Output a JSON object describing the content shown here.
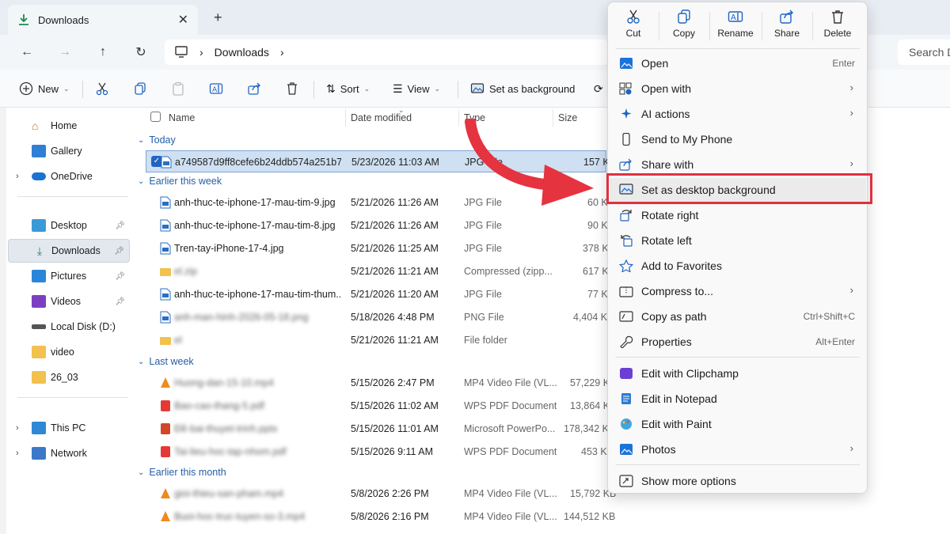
{
  "tab": {
    "title": "Downloads",
    "close": "✕",
    "new": "+"
  },
  "address": {
    "path_label": "Downloads",
    "search_placeholder": "Search D"
  },
  "toolbar": {
    "new_label": "New",
    "sort_label": "Sort",
    "view_label": "View",
    "set_bg_label": "Set as background"
  },
  "sidebar": {
    "home": "Home",
    "gallery": "Gallery",
    "onedrive": "OneDrive",
    "desktop": "Desktop",
    "downloads": "Downloads",
    "pictures": "Pictures",
    "videos": "Videos",
    "localdisk": "Local Disk (D:)",
    "video": "video",
    "f2603": "26_03",
    "thispc": "This PC",
    "network": "Network"
  },
  "columns": {
    "name": "Name",
    "date": "Date modified",
    "type": "Type",
    "size": "Size"
  },
  "groups": {
    "today": "Today",
    "earlier_week": "Earlier this week",
    "last_week": "Last week",
    "earlier_month": "Earlier this month"
  },
  "rows": [
    {
      "name": "a749587d9ff8cefe6b24ddb574a251b7...",
      "date": "5/23/2026 11:03 AM",
      "type": "JPG File",
      "size": "157 KB"
    },
    {
      "name": "anh-thuc-te-iphone-17-mau-tim-9.jpg",
      "date": "5/21/2026 11:26 AM",
      "type": "JPG File",
      "size": "60 KB"
    },
    {
      "name": "anh-thuc-te-iphone-17-mau-tim-8.jpg",
      "date": "5/21/2026 11:26 AM",
      "type": "JPG File",
      "size": "90 KB"
    },
    {
      "name": "Tren-tay-iPhone-17-4.jpg",
      "date": "5/21/2026 11:25 AM",
      "type": "JPG File",
      "size": "378 KB"
    },
    {
      "name": "el.zip",
      "date": "5/21/2026 11:21 AM",
      "type": "Compressed (zipp...",
      "size": "617 KB"
    },
    {
      "name": "anh-thuc-te-iphone-17-mau-tim-thum...",
      "date": "5/21/2026 11:20 AM",
      "type": "JPG File",
      "size": "77 KB"
    },
    {
      "name": "anh-man-hinh-2026-05-18.png",
      "date": "5/18/2026 4:48 PM",
      "type": "PNG File",
      "size": "4,404 KB"
    },
    {
      "name": "el",
      "date": "5/21/2026 11:21 AM",
      "type": "File folder",
      "size": ""
    },
    {
      "name": "Huong-dan-15-10.mp4",
      "date": "5/15/2026 2:47 PM",
      "type": "MP4 Video File (VL...",
      "size": "57,229 KB"
    },
    {
      "name": "Bao-cao-thang-5.pdf",
      "date": "5/15/2026 11:02 AM",
      "type": "WPS PDF Document",
      "size": "13,864 KB"
    },
    {
      "name": "Đề-bai-thuyet-trinh.pptx",
      "date": "5/15/2026 11:01 AM",
      "type": "Microsoft PowerPo...",
      "size": "178,342 KB"
    },
    {
      "name": "Tai-lieu-hoc-tap-nhom.pdf",
      "date": "5/15/2026 9:11 AM",
      "type": "WPS PDF Document",
      "size": "453 KB"
    },
    {
      "name": "gioi-thieu-san-pham.mp4",
      "date": "5/8/2026 2:26 PM",
      "type": "MP4 Video File (VL...",
      "size": "15,792 KB"
    },
    {
      "name": "Buoi-hoc-truc-tuyen-so-3.mp4",
      "date": "5/8/2026 2:16 PM",
      "type": "MP4 Video File (VL...",
      "size": "144,512 KB"
    }
  ],
  "context": {
    "cut": "Cut",
    "copy": "Copy",
    "rename": "Rename",
    "share": "Share",
    "delete": "Delete",
    "open": "Open",
    "open_sc": "Enter",
    "open_with": "Open with",
    "ai_actions": "AI actions",
    "send_phone": "Send to My Phone",
    "share_with": "Share with",
    "set_desktop_bg": "Set as desktop background",
    "rotate_right": "Rotate right",
    "rotate_left": "Rotate left",
    "add_fav": "Add to Favorites",
    "compress": "Compress to...",
    "copy_path": "Copy as path",
    "copy_path_sc": "Ctrl+Shift+C",
    "properties": "Properties",
    "properties_sc": "Alt+Enter",
    "clipchamp": "Edit with Clipchamp",
    "notepad": "Edit in Notepad",
    "paint": "Edit with Paint",
    "photos": "Photos",
    "more": "Show more options"
  },
  "colors": {
    "accent": "#1f64c3",
    "highlight": "#e0303f",
    "group_header": "#245ea8"
  }
}
